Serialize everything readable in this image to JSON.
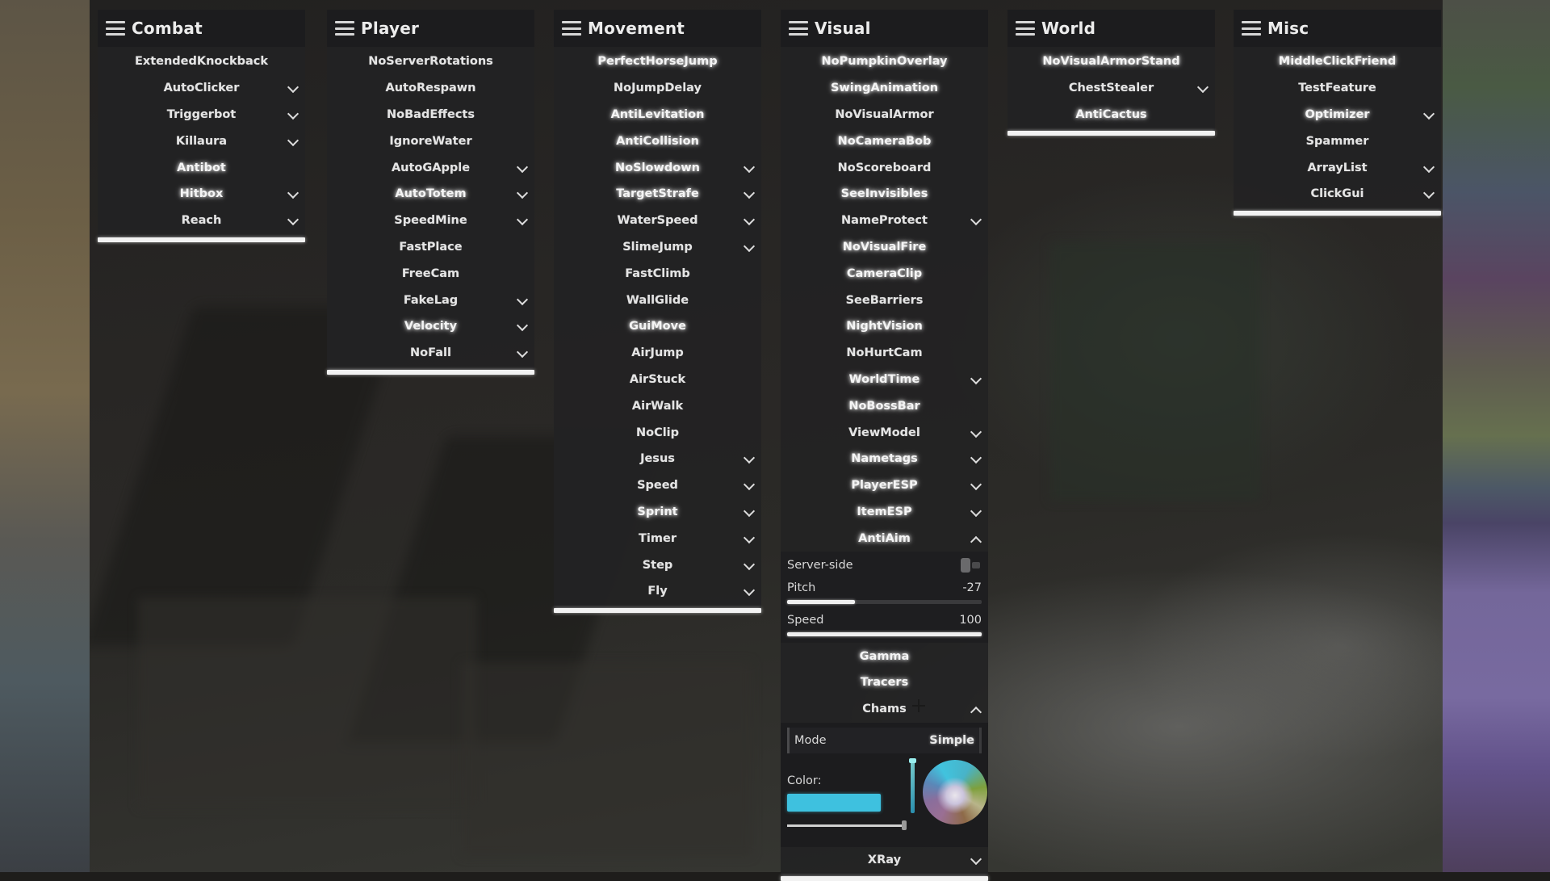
{
  "panels": [
    {
      "id": "combat",
      "title": "Combat",
      "icon": "hamburger-menu-icon",
      "modules": [
        {
          "name": "ExtendedKnockback",
          "enabled": false,
          "expandable": false
        },
        {
          "name": "AutoClicker",
          "enabled": false,
          "expandable": true
        },
        {
          "name": "Triggerbot",
          "enabled": false,
          "expandable": true
        },
        {
          "name": "Killaura",
          "enabled": false,
          "expandable": true
        },
        {
          "name": "Antibot",
          "enabled": true,
          "expandable": false
        },
        {
          "name": "Hitbox",
          "enabled": true,
          "expandable": true
        },
        {
          "name": "Reach",
          "enabled": false,
          "expandable": true
        }
      ]
    },
    {
      "id": "player",
      "title": "Player",
      "icon": "hamburger-menu-icon",
      "modules": [
        {
          "name": "NoServerRotations",
          "enabled": false,
          "expandable": false
        },
        {
          "name": "AutoRespawn",
          "enabled": false,
          "expandable": false
        },
        {
          "name": "NoBadEffects",
          "enabled": false,
          "expandable": false
        },
        {
          "name": "IgnoreWater",
          "enabled": false,
          "expandable": false
        },
        {
          "name": "AutoGApple",
          "enabled": false,
          "expandable": true
        },
        {
          "name": "AutoTotem",
          "enabled": true,
          "expandable": true
        },
        {
          "name": "SpeedMine",
          "enabled": false,
          "expandable": true
        },
        {
          "name": "FastPlace",
          "enabled": false,
          "expandable": false
        },
        {
          "name": "FreeCam",
          "enabled": false,
          "expandable": false
        },
        {
          "name": "FakeLag",
          "enabled": false,
          "expandable": true
        },
        {
          "name": "Velocity",
          "enabled": true,
          "expandable": true
        },
        {
          "name": "NoFall",
          "enabled": false,
          "expandable": true
        }
      ]
    },
    {
      "id": "movement",
      "title": "Movement",
      "icon": "hamburger-menu-icon",
      "modules": [
        {
          "name": "PerfectHorseJump",
          "enabled": true,
          "expandable": false
        },
        {
          "name": "NoJumpDelay",
          "enabled": false,
          "expandable": false
        },
        {
          "name": "AntiLevitation",
          "enabled": true,
          "expandable": false
        },
        {
          "name": "AntiCollision",
          "enabled": true,
          "expandable": false
        },
        {
          "name": "NoSlowdown",
          "enabled": true,
          "expandable": true
        },
        {
          "name": "TargetStrafe",
          "enabled": true,
          "expandable": true
        },
        {
          "name": "WaterSpeed",
          "enabled": false,
          "expandable": true
        },
        {
          "name": "SlimeJump",
          "enabled": false,
          "expandable": true
        },
        {
          "name": "FastClimb",
          "enabled": false,
          "expandable": false
        },
        {
          "name": "WallGlide",
          "enabled": false,
          "expandable": false
        },
        {
          "name": "GuiMove",
          "enabled": true,
          "expandable": false
        },
        {
          "name": "AirJump",
          "enabled": false,
          "expandable": false
        },
        {
          "name": "AirStuck",
          "enabled": false,
          "expandable": false
        },
        {
          "name": "AirWalk",
          "enabled": false,
          "expandable": false
        },
        {
          "name": "NoClip",
          "enabled": false,
          "expandable": false
        },
        {
          "name": "Jesus",
          "enabled": false,
          "expandable": true
        },
        {
          "name": "Speed",
          "enabled": false,
          "expandable": true
        },
        {
          "name": "Sprint",
          "enabled": true,
          "expandable": true
        },
        {
          "name": "Timer",
          "enabled": false,
          "expandable": true
        },
        {
          "name": "Step",
          "enabled": false,
          "expandable": true
        },
        {
          "name": "Fly",
          "enabled": false,
          "expandable": true
        }
      ]
    },
    {
      "id": "visual",
      "title": "Visual",
      "icon": "hamburger-menu-icon",
      "modules": [
        {
          "name": "NoPumpkinOverlay",
          "enabled": true,
          "expandable": false
        },
        {
          "name": "SwingAnimation",
          "enabled": true,
          "expandable": false
        },
        {
          "name": "NoVisualArmor",
          "enabled": false,
          "expandable": false
        },
        {
          "name": "NoCameraBob",
          "enabled": true,
          "expandable": false
        },
        {
          "name": "NoScoreboard",
          "enabled": false,
          "expandable": false
        },
        {
          "name": "SeeInvisibles",
          "enabled": true,
          "expandable": false
        },
        {
          "name": "NameProtect",
          "enabled": false,
          "expandable": true
        },
        {
          "name": "NoVisualFire",
          "enabled": true,
          "expandable": false
        },
        {
          "name": "CameraClip",
          "enabled": true,
          "expandable": false
        },
        {
          "name": "SeeBarriers",
          "enabled": false,
          "expandable": false
        },
        {
          "name": "NightVision",
          "enabled": true,
          "expandable": false
        },
        {
          "name": "NoHurtCam",
          "enabled": false,
          "expandable": false
        },
        {
          "name": "WorldTime",
          "enabled": true,
          "expandable": true
        },
        {
          "name": "NoBossBar",
          "enabled": true,
          "expandable": false
        },
        {
          "name": "ViewModel",
          "enabled": false,
          "expandable": true
        },
        {
          "name": "Nametags",
          "enabled": true,
          "expandable": true
        },
        {
          "name": "PlayerESP",
          "enabled": true,
          "expandable": true
        },
        {
          "name": "ItemESP",
          "enabled": true,
          "expandable": true
        },
        {
          "name": "AntiAim",
          "enabled": true,
          "expandable": true,
          "expanded": true
        }
      ],
      "antiaim_settings": {
        "server_side": {
          "label": "Server-side",
          "value": false
        },
        "pitch": {
          "label": "Pitch",
          "value": "-27",
          "fill_fraction": 0.35
        },
        "speed": {
          "label": "Speed",
          "value": "100",
          "fill_fraction": 1.0
        }
      },
      "modules_after": [
        {
          "name": "Gamma",
          "enabled": true,
          "expandable": false
        },
        {
          "name": "Tracers",
          "enabled": true,
          "expandable": false
        },
        {
          "name": "Chams",
          "enabled": false,
          "expandable": true,
          "expanded": true
        }
      ],
      "chams_settings": {
        "mode": {
          "label": "Mode",
          "value": "Simple"
        },
        "color": {
          "label": "Color:",
          "value": "#3ec1df",
          "alpha_fraction": 1.0
        }
      },
      "modules_tail": [
        {
          "name": "XRay",
          "enabled": false,
          "expandable": true
        }
      ]
    },
    {
      "id": "world",
      "title": "World",
      "icon": "hamburger-menu-icon",
      "modules": [
        {
          "name": "NoVisualArmorStand",
          "enabled": true,
          "expandable": false
        },
        {
          "name": "ChestStealer",
          "enabled": false,
          "expandable": true
        },
        {
          "name": "AntiCactus",
          "enabled": true,
          "expandable": false
        }
      ]
    },
    {
      "id": "misc",
      "title": "Misc",
      "icon": "hamburger-menu-icon",
      "modules": [
        {
          "name": "MiddleClickFriend",
          "enabled": true,
          "expandable": false
        },
        {
          "name": "TestFeature",
          "enabled": false,
          "expandable": false
        },
        {
          "name": "Optimizer",
          "enabled": true,
          "expandable": true
        },
        {
          "name": "Spammer",
          "enabled": false,
          "expandable": false
        },
        {
          "name": "ArrayList",
          "enabled": false,
          "expandable": true
        },
        {
          "name": "ClickGui",
          "enabled": false,
          "expandable": true
        }
      ]
    }
  ],
  "colors": {
    "panel_bg": "#222224",
    "text": "#e4e4e4",
    "footer_bar": "#f2f2f2",
    "chams_color": "#3ec1df"
  }
}
